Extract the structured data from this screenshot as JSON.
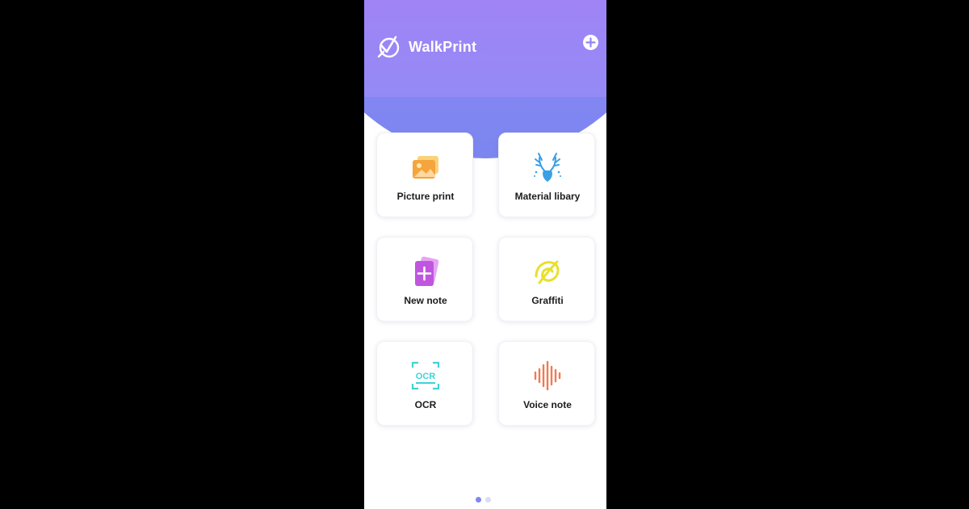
{
  "app": {
    "title": "WalkPrint",
    "brand_color": "#8f86f4"
  },
  "header": {
    "logo_icon": "walkprint-logo-icon",
    "add_icon": "plus-circle-icon"
  },
  "tiles": [
    {
      "label": "Picture print",
      "icon": "picture-icon",
      "color": "#f5a53b"
    },
    {
      "label": "Material libary",
      "icon": "deer-icon",
      "color": "#3aa0e6"
    },
    {
      "label": "New note",
      "icon": "new-note-icon",
      "color": "#c056e0"
    },
    {
      "label": "Graffiti",
      "icon": "graffiti-icon",
      "color": "#e8e02a"
    },
    {
      "label": "OCR",
      "icon": "ocr-scan-icon",
      "color": "#3fd3d6"
    },
    {
      "label": "Voice note",
      "icon": "sound-wave-icon",
      "color": "#f07a52"
    }
  ],
  "pager": {
    "pages": 2,
    "current": 1
  }
}
